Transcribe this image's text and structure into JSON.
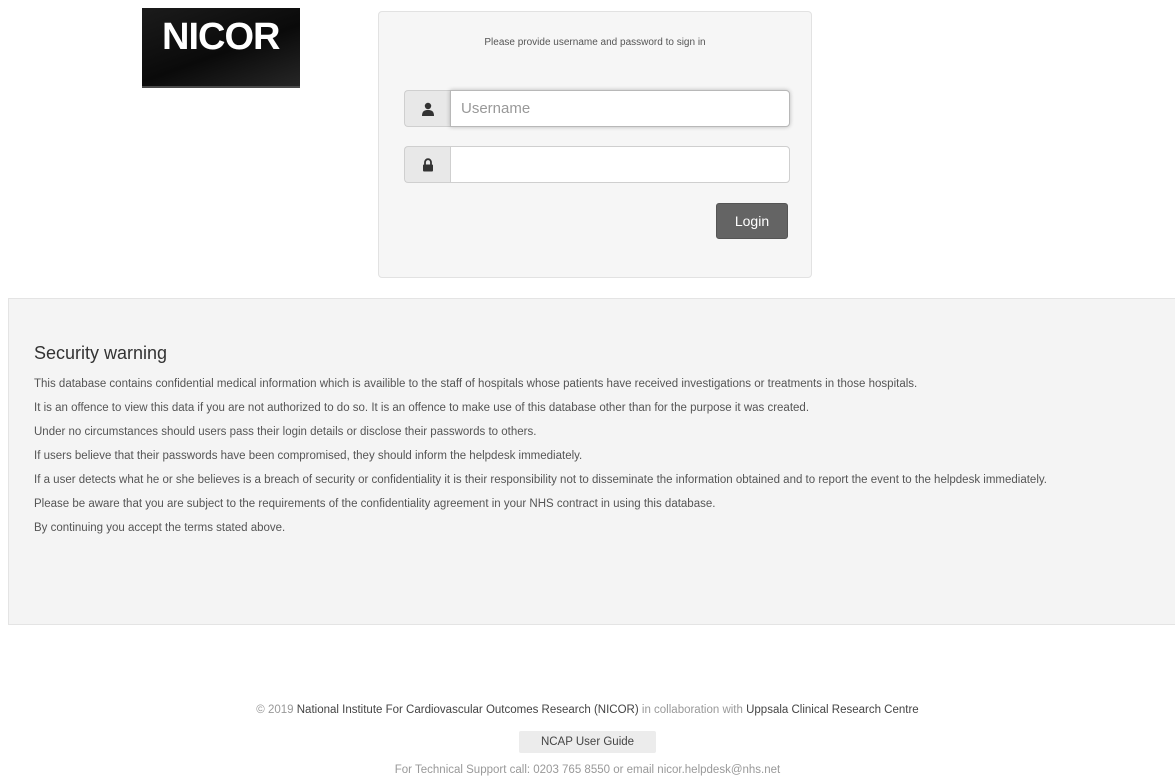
{
  "logo": {
    "text": "NICOR"
  },
  "login": {
    "prompt": "Please provide username and password to sign in",
    "username": {
      "placeholder": "Username",
      "value": ""
    },
    "password": {
      "placeholder": "",
      "value": ""
    },
    "button_label": "Login",
    "icons": {
      "username": "user-icon",
      "password": "lock-icon"
    }
  },
  "warning": {
    "title": "Security warning",
    "paragraphs": [
      "This database contains confidential medical information which is availible to the staff of hospitals whose patients have received investigations or treatments in those hospitals.",
      "It is an offence to view this data if you are not authorized to do so. It is an offence to make use of this database other than for the purpose it was created.",
      "Under no circumstances should users pass their login details or disclose their passwords to others.",
      "If users believe that their passwords have been compromised, they should inform the helpdesk immediately.",
      "If a user detects what he or she believes is a breach of security or confidentiality it is their responsibility not to disseminate the information obtained and to report the event to the helpdesk immediately.",
      "Please be aware that you are subject to the requirements of the confidentiality agreement in your NHS contract in using this database.",
      "By continuing you accept the terms stated above."
    ]
  },
  "footer": {
    "copyright": "© 2019",
    "org": "National Institute For Cardiovascular Outcomes Research (NICOR)",
    "collab": "in collaboration with",
    "partner": "Uppsala Clinical Research Centre",
    "guide_label": "NCAP User Guide",
    "support": "For Technical Support call: 0203 765 8550 or email nicor.helpdesk@nhs.net"
  },
  "colors": {
    "button": "#646464",
    "panel": "#f6f6f6",
    "warning_bg": "#f4f4f4"
  }
}
